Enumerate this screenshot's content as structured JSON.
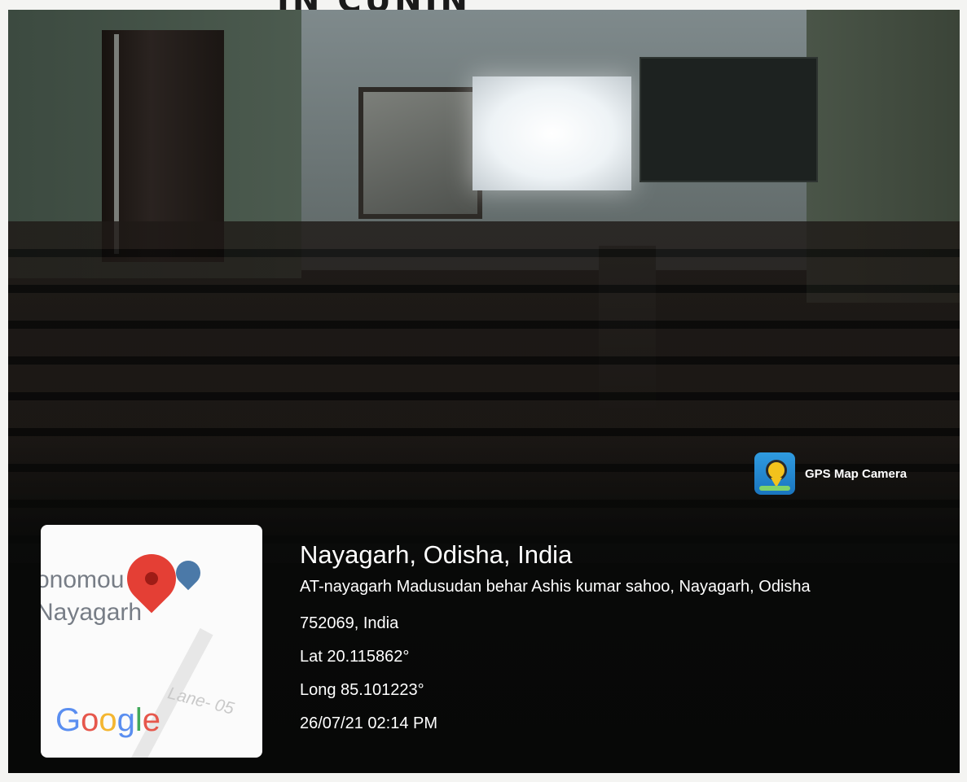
{
  "header": {
    "cut_text": "IN CUNIN"
  },
  "overlay": {
    "app_badge": {
      "label": "GPS Map Camera",
      "icon": "gps-map-camera-icon"
    },
    "map": {
      "place_line_1": "onomou",
      "place_line_2": "Nayagarh",
      "lane_label": "Lane- 05",
      "logo_text": "Google",
      "pin_icon": "map-pin-icon"
    },
    "location": {
      "city": "Nayagarh, Odisha, India",
      "address_line_1": "AT-nayagarh Madusudan behar Ashis kumar sahoo, Nayagarh, Odisha",
      "address_line_2": "752069, India",
      "latitude": "Lat 20.115862°",
      "longitude": "Long 85.101223°",
      "datetime": "26/07/21 02:14 PM"
    }
  },
  "colors": {
    "pin": "#e43f35",
    "app_icon": "#2f9be0",
    "text": "#ffffff"
  }
}
